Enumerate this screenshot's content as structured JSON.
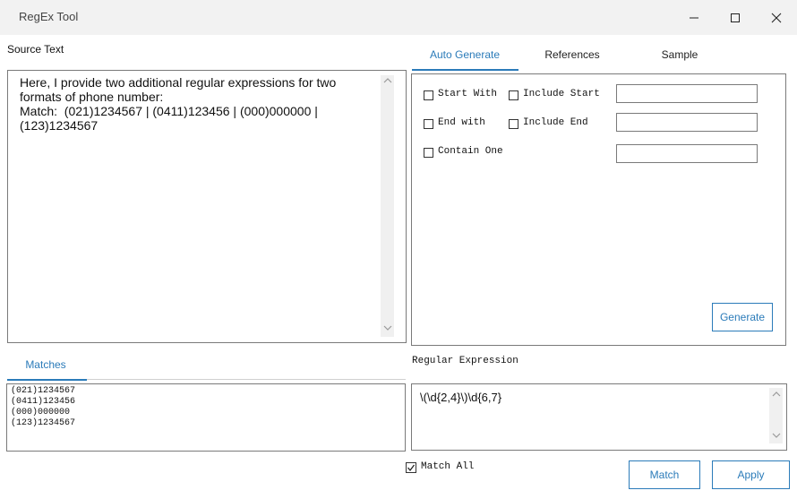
{
  "window": {
    "title": "RegEx Tool",
    "controls": {
      "minimize": "—",
      "maximize": "☐",
      "close": "✕"
    }
  },
  "source": {
    "label": "Source Text",
    "text": "Here, I provide two additional regular expressions for two\nformats of phone number:\nMatch:  (021)1234567 | (0411)123456 | (000)000000 |\n(123)1234567"
  },
  "tabs": [
    {
      "label": "Auto Generate",
      "active": true
    },
    {
      "label": "References",
      "active": false
    },
    {
      "label": "Sample",
      "active": false
    }
  ],
  "autogen": {
    "start_with": "Start With",
    "include_start": "Include Start",
    "end_with": "End with",
    "include_end": "Include End",
    "contain_one": "Contain One",
    "generate_button": "Generate"
  },
  "matches": {
    "tab_label": "Matches",
    "items": [
      "(021)1234567",
      "(0411)123456",
      "(000)000000",
      "(123)1234567"
    ]
  },
  "regex": {
    "label": "Regular Expression",
    "value": "\\(\\d{2,4}\\)\\d{6,7}"
  },
  "match_all": {
    "label": "Match All",
    "checked": true
  },
  "buttons": {
    "match": "Match",
    "apply": "Apply"
  },
  "icons": {
    "check": "check-icon",
    "scroll_up": "chevron-up-icon",
    "scroll_down": "chevron-down-icon"
  },
  "colors": {
    "accent": "#2b7bb9",
    "titlebar": "#f2f2f2",
    "border": "#7a7a7a"
  }
}
